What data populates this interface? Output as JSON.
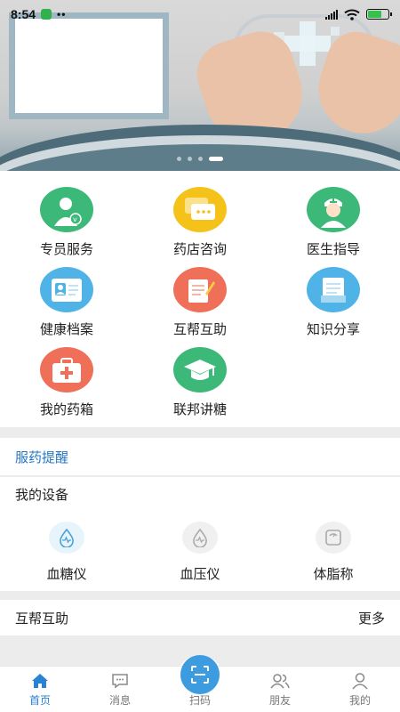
{
  "status_bar": {
    "time": "8:54",
    "dots": "••"
  },
  "banner": {
    "slide_count": 4,
    "active_slide": 4
  },
  "menu": {
    "items": [
      {
        "label": "专员服务",
        "icon": "person-badge-icon",
        "color": "#3cb879"
      },
      {
        "label": "药店咨询",
        "icon": "chat-bubbles-icon",
        "color": "#f5c21a"
      },
      {
        "label": "医生指导",
        "icon": "doctor-icon",
        "color": "#3cb879"
      },
      {
        "label": "健康档案",
        "icon": "id-card-icon",
        "color": "#4fb3e8"
      },
      {
        "label": "互帮互助",
        "icon": "notepad-icon",
        "color": "#ef6f59"
      },
      {
        "label": "知识分享",
        "icon": "document-icon",
        "color": "#4fb3e8"
      },
      {
        "label": "我的药箱",
        "icon": "medicine-box-icon",
        "color": "#ef6f59"
      },
      {
        "label": "联邦讲糖",
        "icon": "graduation-cap-icon",
        "color": "#3cb879"
      }
    ]
  },
  "reminder": {
    "title": "服药提醒"
  },
  "devices": {
    "title": "我的设备",
    "items": [
      {
        "label": "血糖仪",
        "icon": "blood-drop-icon",
        "active": true
      },
      {
        "label": "血压仪",
        "icon": "blood-drop-icon",
        "active": false
      },
      {
        "label": "体脂称",
        "icon": "scale-icon",
        "active": false
      }
    ]
  },
  "mutual": {
    "title": "互帮互助",
    "more": "更多"
  },
  "tabbar": {
    "tabs": [
      {
        "label": "首页",
        "icon": "home-icon",
        "active": true
      },
      {
        "label": "消息",
        "icon": "message-icon",
        "active": false
      },
      {
        "label": "扫码",
        "icon": "scan-icon",
        "active": false
      },
      {
        "label": "朋友",
        "icon": "friends-icon",
        "active": false
      },
      {
        "label": "我的",
        "icon": "profile-icon",
        "active": false
      }
    ]
  },
  "colors": {
    "accent": "#2a82d4",
    "reminder_text": "#2377c4",
    "scan_button": "#3d9be0"
  }
}
